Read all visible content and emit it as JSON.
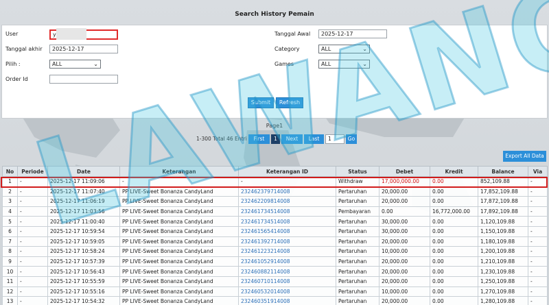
{
  "page": {
    "title": "Search History Pemain"
  },
  "form": {
    "user_label": "User",
    "user_value": "y",
    "tanggal_awal_label": "Tanggal Awal",
    "tanggal_awal_value": "2025-12-17",
    "tanggal_akhir_label": "Tanggal akhir",
    "tanggal_akhir_value": "2025-12-17",
    "category_label": "Category",
    "category_value": "ALL",
    "pilih_label": "Pilih  :",
    "pilih_value": "ALL",
    "games_label": "Games",
    "games_value": "ALL",
    "order_label": "Order Id",
    "order_value": "",
    "submit_label": "Submit",
    "refresh_label": "Refresh"
  },
  "pager": {
    "page_label": "Page1",
    "info": "1-300 Total 46 Entri",
    "first": "First",
    "current": "1",
    "next": "Next",
    "last": "Last",
    "page_input": "1",
    "go": "Go"
  },
  "export_label": "Export All Data",
  "watermark": "LAWANGSLOT",
  "table": {
    "headers": [
      "No",
      "Periode",
      "Date",
      "Keterangan",
      "Keterangan ID",
      "Status",
      "Debet",
      "Kredit",
      "Balance",
      "Via"
    ],
    "rows": [
      [
        "1",
        "-",
        "2025-12-17 11:09:06",
        "-",
        "-",
        "Withdraw",
        "17,000,000.00",
        "0.00",
        "852,109.88",
        "-"
      ],
      [
        "2",
        "-",
        "2025-12-17 11:07:40",
        "PP LIVE-Sweet Bonanza CandyLand",
        "232462379714008",
        "Pertaruhan",
        "20,000.00",
        "0.00",
        "17,852,109.88",
        "-"
      ],
      [
        "3",
        "-",
        "2025-12-17 11:06:19",
        "PP LIVE-Sweet Bonanza CandyLand",
        "232462209814008",
        "Pertaruhan",
        "20,000.00",
        "0.00",
        "17,872,109.88",
        "-"
      ],
      [
        "4",
        "-",
        "2025-12-17 11:03:56",
        "PP LIVE-Sweet Bonanza CandyLand",
        "232461734514008",
        "Pembayaran",
        "0.00",
        "16,772,000.00",
        "17,892,109.88",
        "-"
      ],
      [
        "5",
        "-",
        "2025-12-17 11:00:40",
        "PP LIVE-Sweet Bonanza CandyLand",
        "232461734514008",
        "Pertaruhan",
        "30,000.00",
        "0.00",
        "1,120,109.88",
        "-"
      ],
      [
        "6",
        "-",
        "2025-12-17 10:59:54",
        "PP LIVE-Sweet Bonanza CandyLand",
        "232461565414008",
        "Pertaruhan",
        "30,000.00",
        "0.00",
        "1,150,109.88",
        "-"
      ],
      [
        "7",
        "-",
        "2025-12-17 10:59:05",
        "PP LIVE-Sweet Bonanza CandyLand",
        "232461392714008",
        "Pertaruhan",
        "20,000.00",
        "0.00",
        "1,180,109.88",
        "-"
      ],
      [
        "8",
        "-",
        "2025-12-17 10:58:24",
        "PP LIVE-Sweet Bonanza CandyLand",
        "232461223214008",
        "Pertaruhan",
        "10,000.00",
        "0.00",
        "1,200,109.88",
        "-"
      ],
      [
        "9",
        "-",
        "2025-12-17 10:57:39",
        "PP LIVE-Sweet Bonanza CandyLand",
        "232461052914008",
        "Pertaruhan",
        "20,000.00",
        "0.00",
        "1,210,109.88",
        "-"
      ],
      [
        "10",
        "-",
        "2025-12-17 10:56:43",
        "PP LIVE-Sweet Bonanza CandyLand",
        "232460882114008",
        "Pertaruhan",
        "20,000.00",
        "0.00",
        "1,230,109.88",
        "-"
      ],
      [
        "11",
        "-",
        "2025-12-17 10:55:59",
        "PP LIVE-Sweet Bonanza CandyLand",
        "232460710114008",
        "Pertaruhan",
        "20,000.00",
        "0.00",
        "1,250,109.88",
        "-"
      ],
      [
        "12",
        "-",
        "2025-12-17 10:55:16",
        "PP LIVE-Sweet Bonanza CandyLand",
        "232460532014008",
        "Pertaruhan",
        "10,000.00",
        "0.00",
        "1,270,109.88",
        "-"
      ],
      [
        "13",
        "-",
        "2025-12-17 10:54:32",
        "PP LIVE-Sweet Bonanza CandyLand",
        "232460351914008",
        "Pertaruhan",
        "20,000.00",
        "0.00",
        "1,280,109.88",
        "-"
      ]
    ]
  }
}
